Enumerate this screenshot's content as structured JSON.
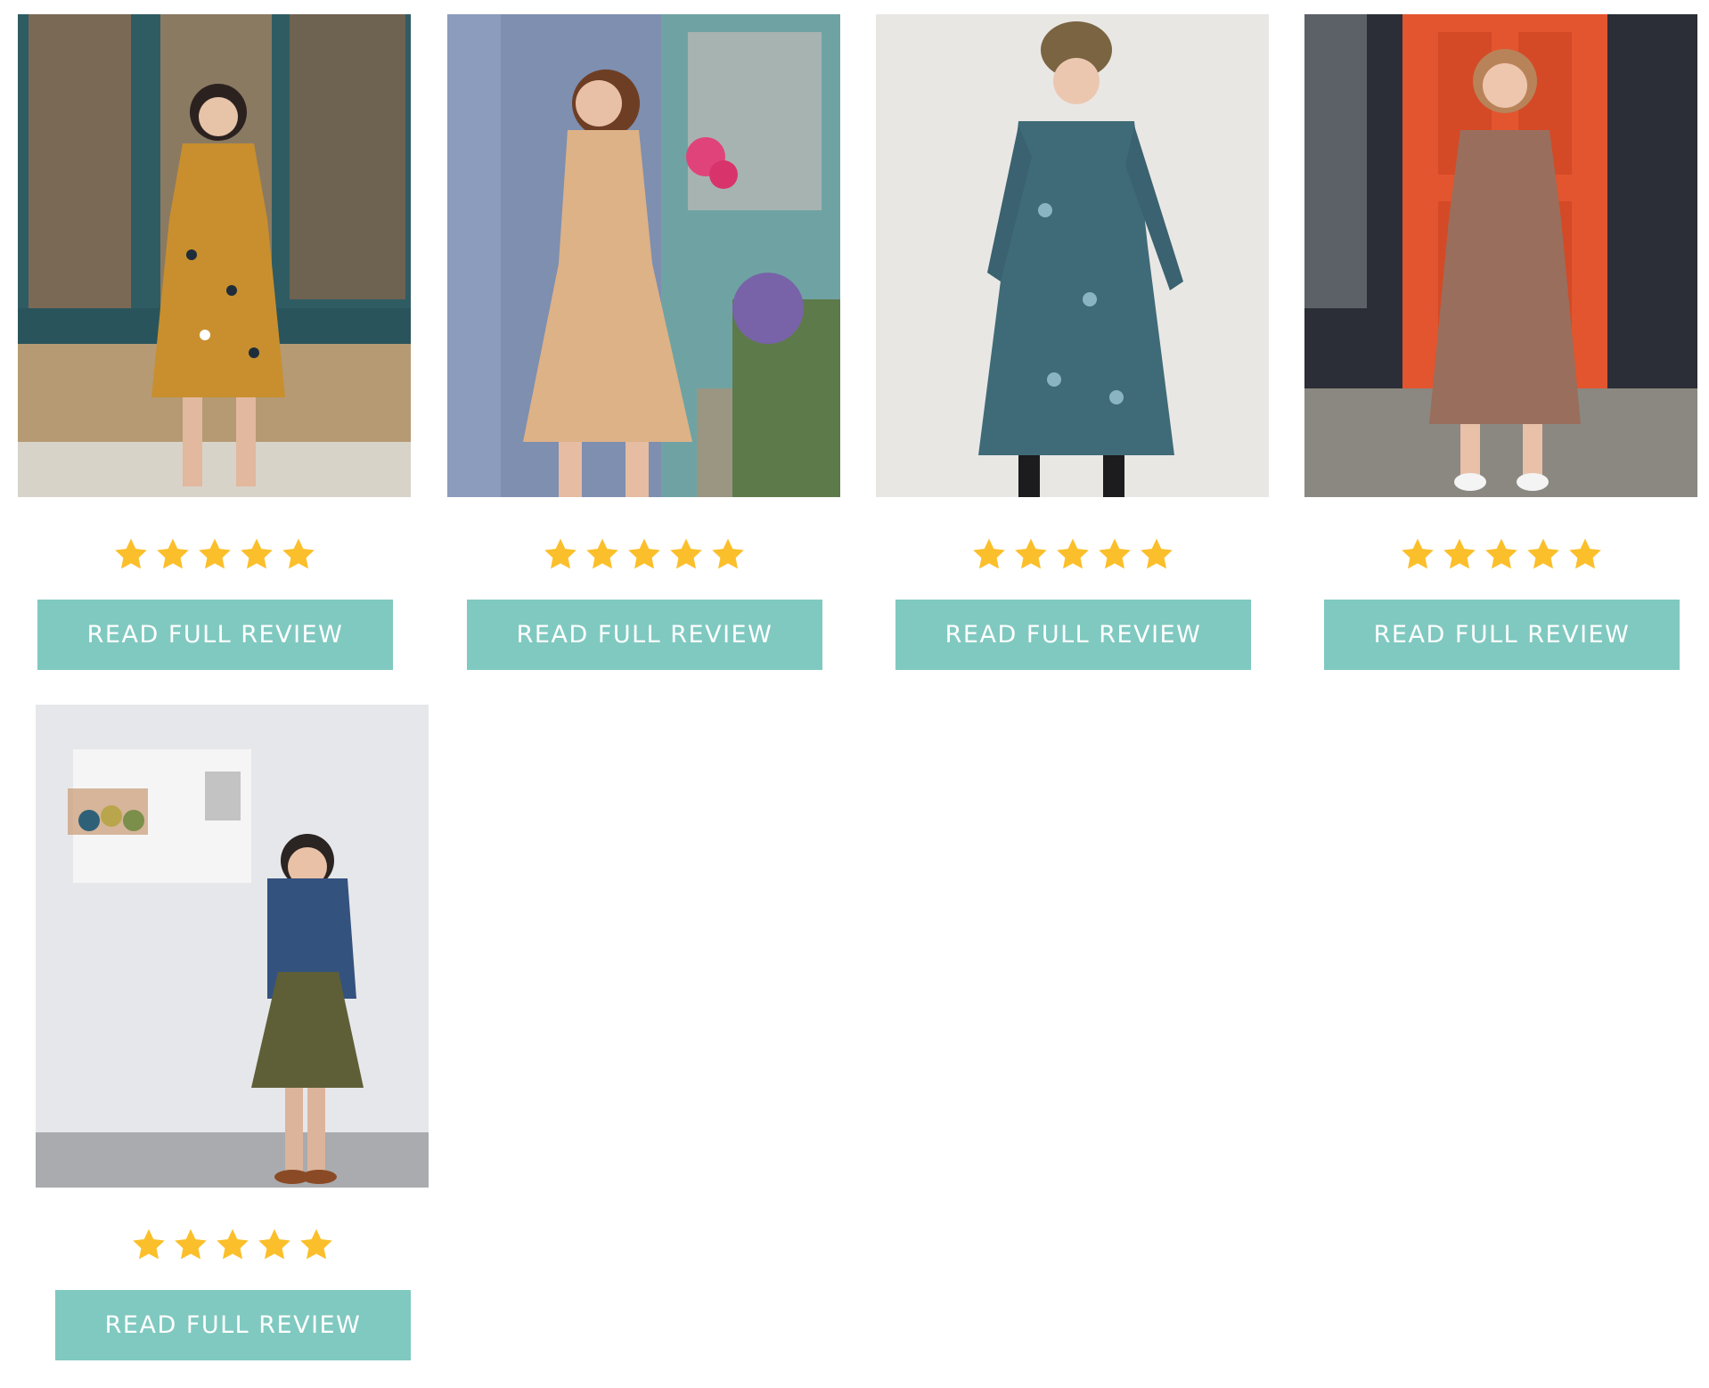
{
  "colors": {
    "button": "#80c9c0",
    "button_text": "#ffffff",
    "star": "#fbbf2b"
  },
  "reviews": [
    {
      "rating": 5,
      "button_label": "READ FULL REVIEW",
      "icon": "star-icon"
    },
    {
      "rating": 5,
      "button_label": "READ FULL REVIEW",
      "icon": "star-icon"
    },
    {
      "rating": 5,
      "button_label": "READ FULL REVIEW",
      "icon": "star-icon"
    },
    {
      "rating": 5,
      "button_label": "READ FULL REVIEW",
      "icon": "star-icon"
    },
    {
      "rating": 5,
      "button_label": "READ FULL REVIEW",
      "icon": "star-icon"
    }
  ]
}
